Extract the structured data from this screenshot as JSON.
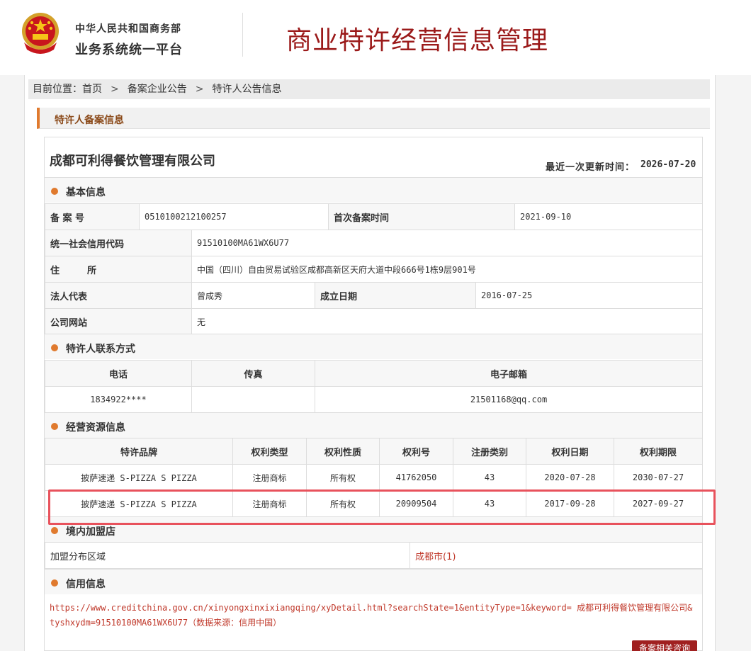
{
  "header": {
    "gov_name": "中华人民共和国商务部",
    "platform": "业务系统统一平台",
    "site_title": "商业特许经营信息管理"
  },
  "breadcrumb": {
    "prefix": "目前位置：",
    "items": [
      "首页",
      "备案企业公告",
      "特许人公告信息"
    ],
    "separator": ">"
  },
  "panel": {
    "title": "特许人备案信息"
  },
  "company": {
    "name": "成都可利得餐饮管理有限公司",
    "update_label": "最近一次更新时间：",
    "update_date": "2026-07-20"
  },
  "basic": {
    "title": "基本信息",
    "filing_no_label": "备 案 号",
    "filing_no": "0510100212100257",
    "first_filing_label": "首次备案时间",
    "first_filing_date": "2021-09-10",
    "credit_code_label": "统一社会信用代码",
    "credit_code": "91510100MA61WX6U77",
    "address_label": "住　　　所",
    "address": "中国（四川）自由贸易试验区成都高新区天府大道中段666号1栋9层901号",
    "legal_rep_label": "法人代表",
    "legal_rep": "曾成秀",
    "founded_label": "成立日期",
    "founded_date": "2016-07-25",
    "website_label": "公司网站",
    "website": "无"
  },
  "contact": {
    "title": "特许人联系方式",
    "headers": [
      "电话",
      "传真",
      "电子邮箱"
    ],
    "phone": "1834922****",
    "fax": "",
    "email": "21501168@qq.com"
  },
  "resources": {
    "title": "经营资源信息",
    "headers": [
      "特许品牌",
      "权利类型",
      "权利性质",
      "权利号",
      "注册类别",
      "权利日期",
      "权利期限"
    ],
    "rows": [
      [
        "披萨速递 S-PIZZA S PIZZA",
        "注册商标",
        "所有权",
        "41762050",
        "43",
        "2020-07-28",
        "2030-07-27"
      ],
      [
        "披萨速递 S-PIZZA S PIZZA",
        "注册商标",
        "所有权",
        "20909504",
        "43",
        "2017-09-28",
        "2027-09-27"
      ]
    ]
  },
  "stores": {
    "title": "境内加盟店",
    "label": "加盟分布区域",
    "value": "成都市(1)"
  },
  "credit": {
    "title": "信用信息",
    "link_text": "https://www.creditchina.gov.cn/xinyongxinxixiangqing/xyDetail.html?searchState=1&entityType=1&keyword= 成都可利得餐饮管理有限公司&tyshxydm=91510100MA61WX6U77（数据来源：信用中国）"
  },
  "buttons": {
    "filing_query": "备案相关咨询"
  },
  "colors": {
    "accent": "#e07a2e",
    "title_red": "#9b1a1a",
    "link_red": "#c0392b",
    "highlight": "#e8525c",
    "button": "#a02020"
  },
  "icons": {
    "emblem": "national-emblem-icon",
    "section_marker": "orange-dot-icon"
  }
}
